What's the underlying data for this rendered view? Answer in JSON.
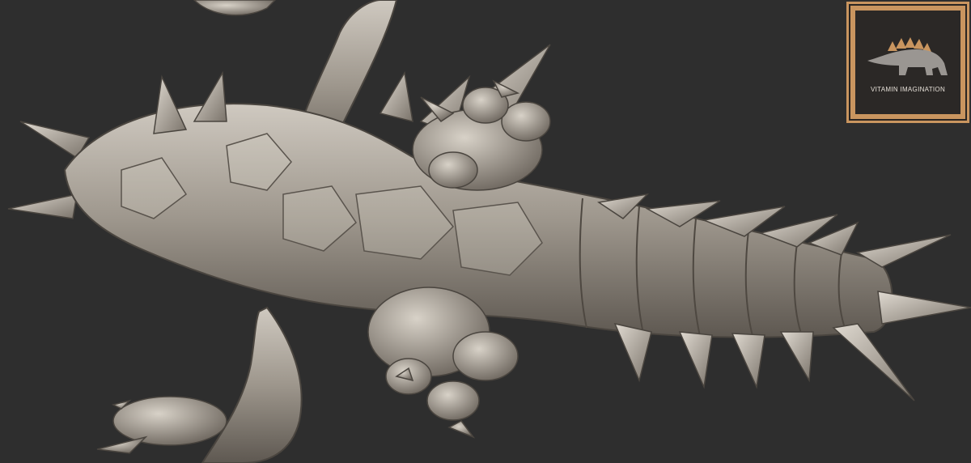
{
  "image": {
    "subject": "",
    "background_color": "#2e2e2e",
    "model_color": "#a9a39a"
  },
  "watermark": {
    "text": "VITAMIN IMAGINATION",
    "frame_color": "#c9955f",
    "icon": "stegosaurus-icon"
  }
}
